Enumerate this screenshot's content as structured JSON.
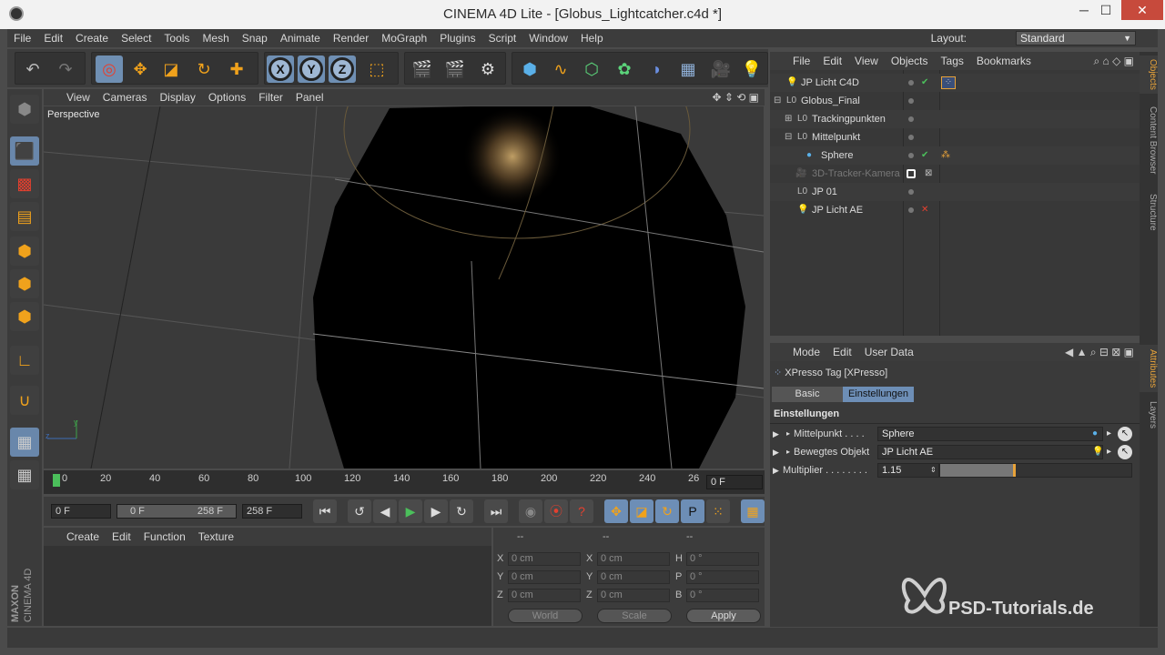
{
  "window": {
    "title": "CINEMA 4D Lite - [Globus_Lightcatcher.c4d *]",
    "minimize": "─",
    "maximize": "☐",
    "close": "✕"
  },
  "menubar": {
    "items": [
      "File",
      "Edit",
      "Create",
      "Select",
      "Tools",
      "Mesh",
      "Snap",
      "Animate",
      "Render",
      "MoGraph",
      "Plugins",
      "Script",
      "Window",
      "Help"
    ],
    "layout_label": "Layout:",
    "layout_value": "Standard"
  },
  "viewport": {
    "menu": [
      "View",
      "Cameras",
      "Display",
      "Options",
      "Filter",
      "Panel"
    ],
    "label": "Perspective",
    "axis_y": "y",
    "axis_z": "z"
  },
  "timeline": {
    "ticks": [
      "0",
      "20",
      "40",
      "60",
      "80",
      "100",
      "120",
      "140",
      "160",
      "180",
      "200",
      "220",
      "240",
      "26"
    ],
    "current_frame": "0 F"
  },
  "playbar": {
    "start": "0 F",
    "range_start": "0 F",
    "range_end": "258 F",
    "end": "258 F"
  },
  "material_manager": {
    "menu": [
      "Create",
      "Edit",
      "Function",
      "Texture"
    ]
  },
  "coordinates": {
    "col_headers": [
      "--",
      "--",
      "--"
    ],
    "rows": [
      {
        "a": "X",
        "av": "0 cm",
        "b": "X",
        "bv": "0 cm",
        "c": "H",
        "cv": "0 °"
      },
      {
        "a": "Y",
        "av": "0 cm",
        "b": "Y",
        "bv": "0 cm",
        "c": "P",
        "cv": "0 °"
      },
      {
        "a": "Z",
        "av": "0 cm",
        "b": "Z",
        "bv": "0 cm",
        "c": "B",
        "cv": "0 °"
      }
    ],
    "world": "World",
    "scale": "Scale",
    "apply": "Apply"
  },
  "object_manager": {
    "menu": [
      "File",
      "Edit",
      "View",
      "Objects",
      "Tags",
      "Bookmarks"
    ],
    "objects": [
      {
        "name": "JP Licht C4D"
      },
      {
        "name": "Globus_Final"
      },
      {
        "name": "Trackingpunkten"
      },
      {
        "name": "Mittelpunkt"
      },
      {
        "name": "Sphere"
      },
      {
        "name": "3D-Tracker-Kamera"
      },
      {
        "name": "JP 01"
      },
      {
        "name": "JP Licht AE"
      }
    ]
  },
  "side_tabs": {
    "top": [
      "Objects",
      "Content Browser",
      "Structure"
    ],
    "bottom": [
      "Attributes",
      "Layers"
    ]
  },
  "attributes": {
    "menu": [
      "Mode",
      "Edit",
      "User Data"
    ],
    "header": "XPresso Tag [XPresso]",
    "tabs": [
      "Basic",
      "Einstellungen"
    ],
    "section": "Einstellungen",
    "fields": [
      {
        "label": "Mittelpunkt . . . .",
        "value": "Sphere"
      },
      {
        "label": "Bewegtes Objekt",
        "value": "JP Licht AE"
      },
      {
        "label": "Multiplier . . . . . . . .",
        "value": "1.15"
      }
    ],
    "multiplier_fraction": 0.38
  },
  "branding": {
    "maxon": "MAXON",
    "cinema": "CINEMA 4D",
    "watermark": "PSD-Tutorials.de"
  },
  "colors": {
    "accent": "#e8a33a",
    "active_blue": "#6d8eb6",
    "bg": "#4b4b4b"
  }
}
